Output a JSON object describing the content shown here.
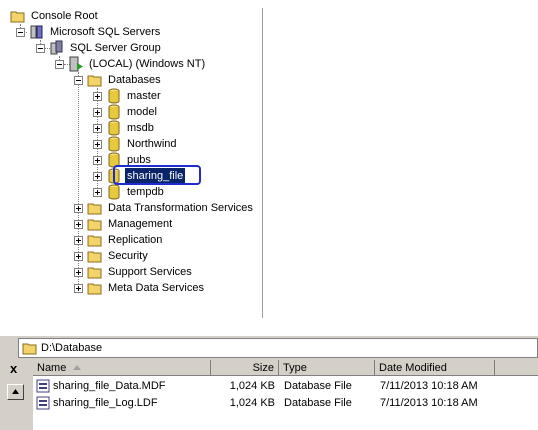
{
  "tree": {
    "nodes": [
      {
        "label": "Console Root",
        "icon": "folder-icon"
      },
      {
        "label": "Microsoft SQL Servers",
        "icon": "server-group-icon"
      },
      {
        "label": "SQL Server Group",
        "icon": "server-group-icon"
      },
      {
        "label": "(LOCAL) (Windows NT)",
        "icon": "server-running-icon"
      },
      {
        "label": "Databases",
        "icon": "folder-icon"
      },
      {
        "label": "master",
        "icon": "database-icon"
      },
      {
        "label": "model",
        "icon": "database-icon"
      },
      {
        "label": "msdb",
        "icon": "database-icon"
      },
      {
        "label": "Northwind",
        "icon": "database-icon"
      },
      {
        "label": "pubs",
        "icon": "database-icon"
      },
      {
        "label": "sharing_file",
        "icon": "database-icon",
        "selected": true
      },
      {
        "label": "tempdb",
        "icon": "database-icon"
      },
      {
        "label": "Data Transformation Services",
        "icon": "folder-icon"
      },
      {
        "label": "Management",
        "icon": "folder-icon"
      },
      {
        "label": "Replication",
        "icon": "folder-icon"
      },
      {
        "label": "Security",
        "icon": "folder-icon"
      },
      {
        "label": "Support Services",
        "icon": "folder-icon"
      },
      {
        "label": "Meta Data Services",
        "icon": "folder-icon"
      }
    ]
  },
  "explorer": {
    "address": "D:\\Database",
    "columns": {
      "name": "Name",
      "size": "Size",
      "type": "Type",
      "modified": "Date Modified"
    },
    "files": [
      {
        "name": "sharing_file_Data.MDF",
        "size": "1,024 KB",
        "type": "Database File",
        "modified": "7/11/2013 10:18 AM"
      },
      {
        "name": "sharing_file_Log.LDF",
        "size": "1,024 KB",
        "type": "Database File",
        "modified": "7/11/2013 10:18 AM"
      }
    ],
    "close_glyph": "x"
  },
  "colors": {
    "highlight": "#1c2ccf",
    "folder": "#f2d46a",
    "database": "#e8c840"
  }
}
